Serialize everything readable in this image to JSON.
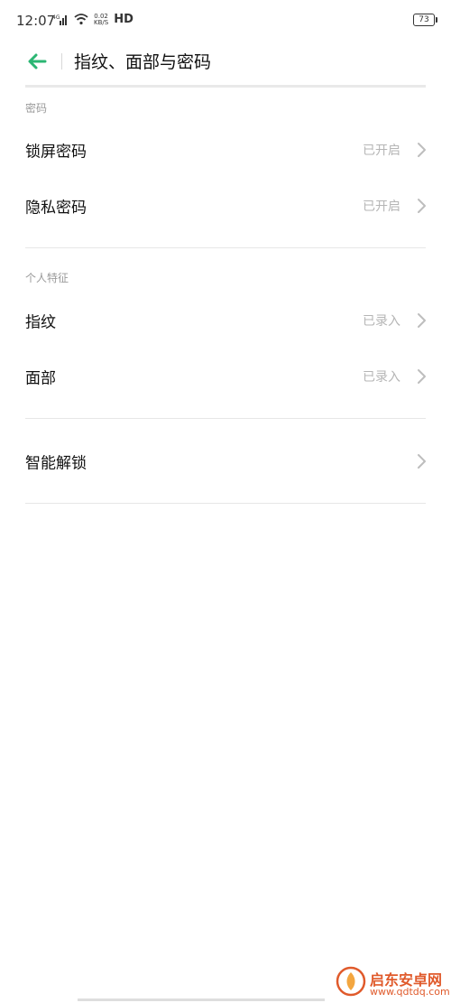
{
  "status_bar": {
    "time": "12:07",
    "network": "4G",
    "speed_value": "0.02",
    "speed_unit": "KB/S",
    "hd": "HD",
    "battery": "73"
  },
  "header": {
    "title": "指纹、面部与密码"
  },
  "sections": [
    {
      "title": "密码",
      "items": [
        {
          "label": "锁屏密码",
          "status": "已开启"
        },
        {
          "label": "隐私密码",
          "status": "已开启"
        }
      ]
    },
    {
      "title": "个人特征",
      "items": [
        {
          "label": "指纹",
          "status": "已录入"
        },
        {
          "label": "面部",
          "status": "已录入"
        }
      ]
    },
    {
      "title": "",
      "items": [
        {
          "label": "智能解锁",
          "status": ""
        }
      ]
    }
  ],
  "watermark": {
    "name": "启东安卓网",
    "url": "www.qdtdq.com"
  },
  "colors": {
    "accent": "#2bb673",
    "watermark": "#e05a2b"
  }
}
